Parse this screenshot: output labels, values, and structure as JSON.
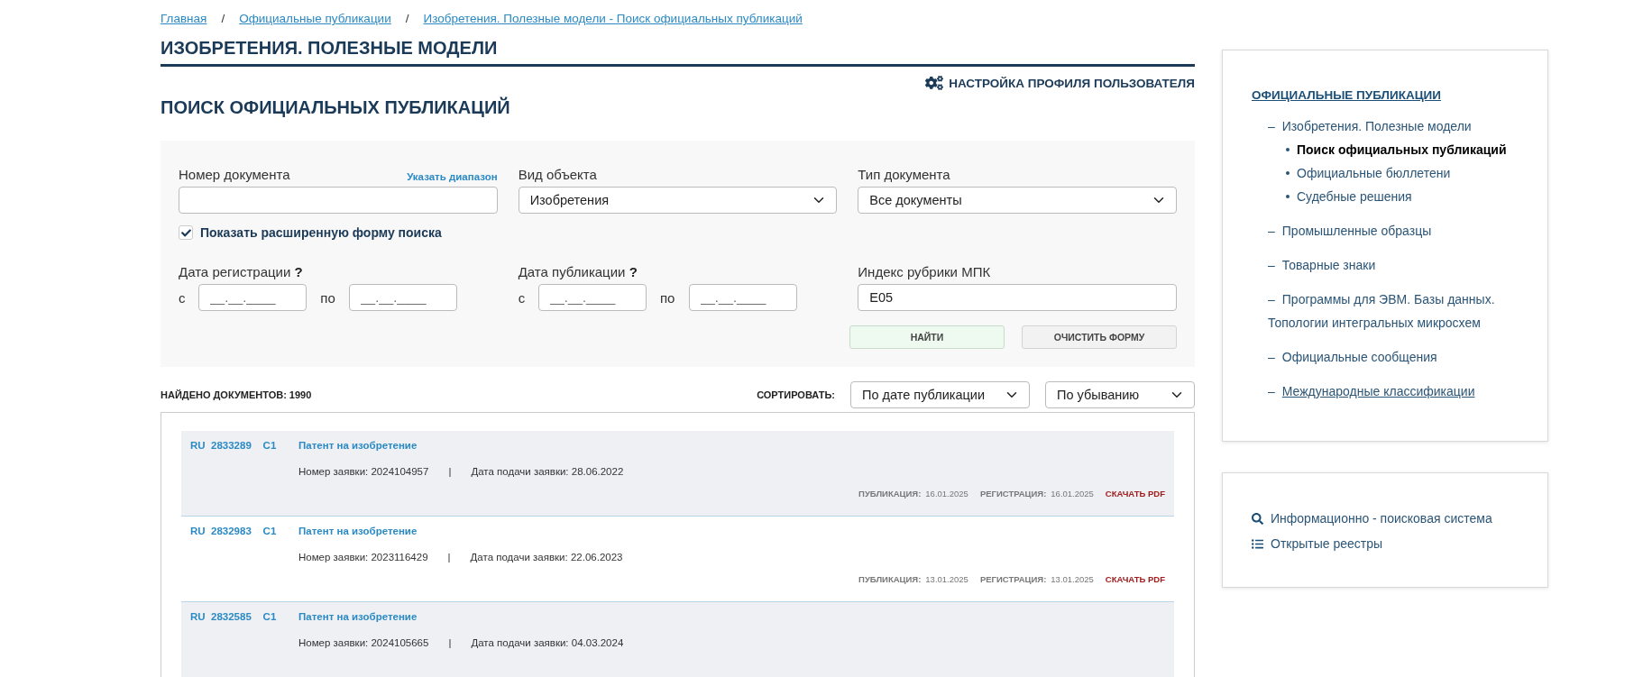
{
  "breadcrumbs": [
    {
      "label": "Главная"
    },
    {
      "label": "Официальные публикации"
    },
    {
      "label": "Изобретения. Полезные модели - Поиск официальных публикаций"
    }
  ],
  "breadcrumb_separator": "/",
  "section_title": "ИЗОБРЕТЕНИЯ. ПОЛЕЗНЫЕ МОДЕЛИ",
  "profile_link": "НАСТРОЙКА ПРОФИЛЯ ПОЛЬЗОВАТЕЛЯ",
  "page_title": "ПОИСК ОФИЦИАЛЬНЫХ ПУБЛИКАЦИЙ",
  "search_form": {
    "document_number": {
      "label": "Номер документа",
      "range_link": "Указать диапазон"
    },
    "object_type": {
      "label": "Вид объекта",
      "value": "Изобретения"
    },
    "document_type": {
      "label": "Тип документа",
      "value": "Все документы"
    },
    "advanced": {
      "label": "Показать расширенную форму поиска",
      "checked": true
    },
    "registration_date": {
      "label": "Дата регистрации",
      "help": "?",
      "from_label": "с",
      "from_placeholder": "__.__.____",
      "to_label": "по",
      "to_placeholder": "__.__.____"
    },
    "publication_date": {
      "label": "Дата публикации",
      "help": "?",
      "from_label": "с",
      "from_placeholder": "__.__.____",
      "to_label": "по",
      "to_placeholder": "__.__.____"
    },
    "ipc_index": {
      "label": "Индекс рубрики МПК",
      "value": "E05"
    },
    "buttons": [
      {
        "label": "НАЙТИ",
        "kind": "primary"
      },
      {
        "label": "ОЧИСТИТЬ ФОРМУ",
        "kind": "secondary"
      }
    ]
  },
  "results_summary": "НАЙДЕНО ДОКУМЕНТОВ: 1990",
  "sort": {
    "label": "СОРТИРОВАТЬ:",
    "field": "По дате публикации",
    "order": "По убыванию"
  },
  "results": [
    {
      "country": "RU",
      "number": "2833289",
      "code": "C1",
      "title": "Патент на изобретение",
      "application": "Номер заявки: 2024104957",
      "separator": "|",
      "filing": "Дата подачи заявки: 28.06.2022",
      "publication_label": "ПУБЛИКАЦИЯ:",
      "publication_date": "16.01.2025",
      "registration_label": "РЕГИСТРАЦИЯ:",
      "registration_date": "16.01.2025",
      "download": "СКАЧАТЬ PDF",
      "shaded": true
    },
    {
      "country": "RU",
      "number": "2832983",
      "code": "C1",
      "title": "Патент на изобретение",
      "application": "Номер заявки: 2023116429",
      "separator": "|",
      "filing": "Дата подачи заявки: 22.06.2023",
      "publication_label": "ПУБЛИКАЦИЯ:",
      "publication_date": "13.01.2025",
      "registration_label": "РЕГИСТРАЦИЯ:",
      "registration_date": "13.01.2025",
      "download": "СКАЧАТЬ PDF",
      "shaded": false
    },
    {
      "country": "RU",
      "number": "2832585",
      "code": "C1",
      "title": "Патент на изобретение",
      "application": "Номер заявки: 2024105665",
      "separator": "|",
      "filing": "Дата подачи заявки: 04.03.2024",
      "shaded": true
    }
  ],
  "sidebar": {
    "title": "ОФИЦИАЛЬНЫЕ ПУБЛИКАЦИИ",
    "items": [
      {
        "marker": "–",
        "label": "Изобретения. Полезные модели",
        "selected": false,
        "children": [
          {
            "label": "Поиск официальных публикаций",
            "selected": true
          },
          {
            "label": "Официальные бюллетени",
            "selected": false
          },
          {
            "label": "Судебные решения",
            "selected": false
          }
        ]
      },
      {
        "marker": "–",
        "label": "Промышленные образцы",
        "selected": false
      },
      {
        "marker": "–",
        "label": "Товарные знаки",
        "selected": false
      },
      {
        "marker": "–",
        "label": "Программы для ЭВМ. Базы данных. Топологии интегральных микросхем",
        "selected": false
      },
      {
        "marker": "–",
        "label": "Официальные сообщения",
        "selected": false
      },
      {
        "marker": "–",
        "label": "Международные классификации",
        "selected": false,
        "underlined": true
      }
    ]
  },
  "quick_links": [
    {
      "label": "Информационно - поисковая система",
      "kind": "search"
    },
    {
      "label": "Открытые реестры",
      "kind": "list"
    }
  ]
}
